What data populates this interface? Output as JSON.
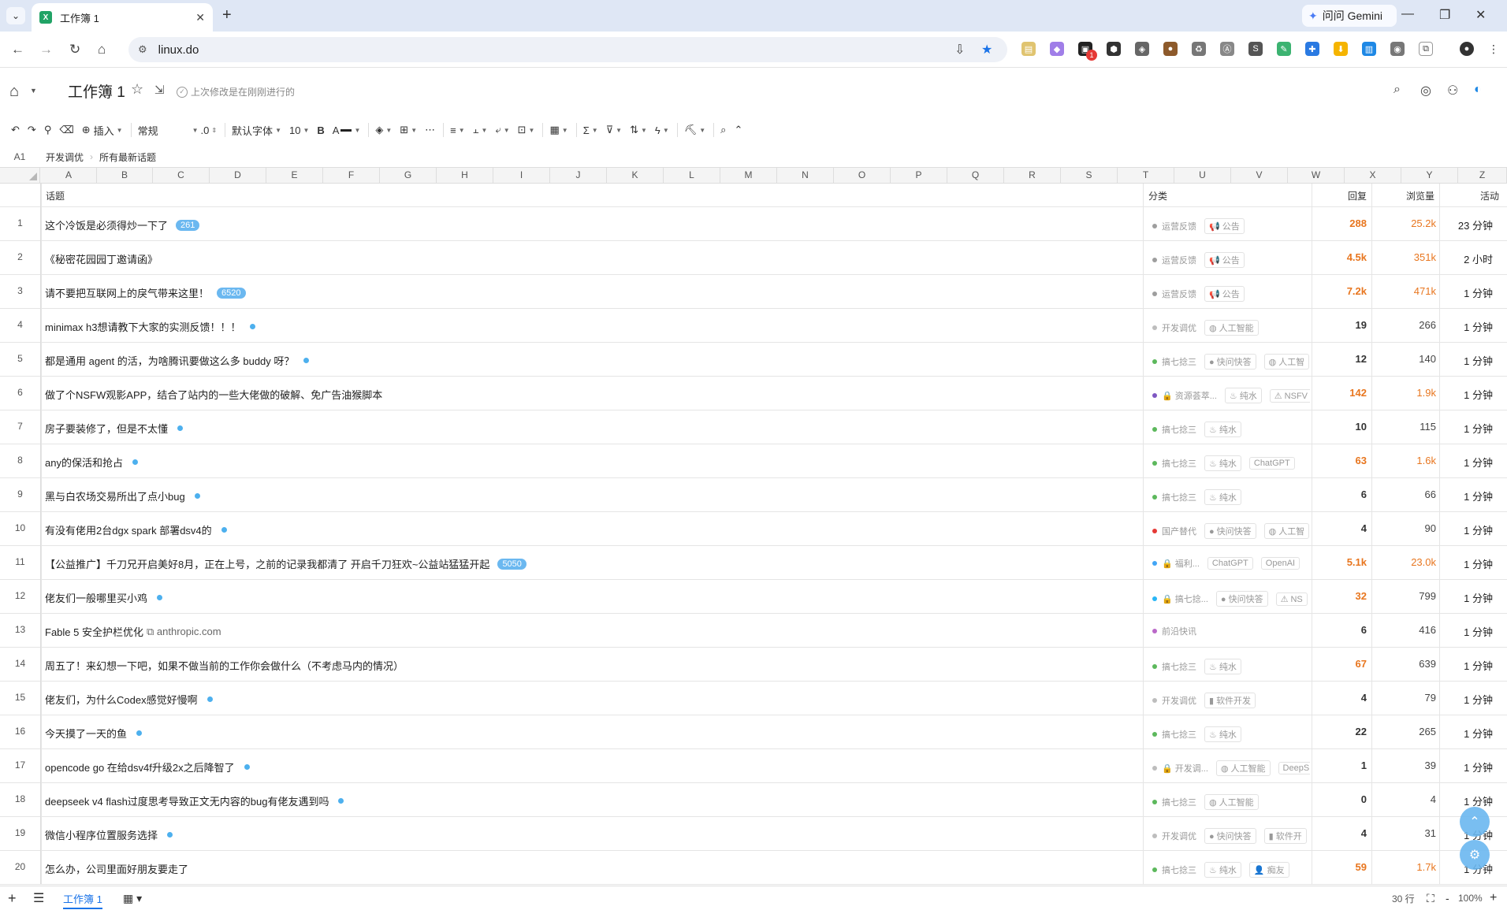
{
  "browser": {
    "tab_title": "工作簿 1",
    "tab_favicon": "X",
    "new_tab": "+",
    "tab_list": "⌄",
    "gemini_label": "问问 Gemini",
    "url": "linux.do",
    "ext_badge": "1"
  },
  "app": {
    "doc_title": "工作簿 1",
    "save_status": "上次修改是在刚刚进行的"
  },
  "toolbar": {
    "insert": "插入",
    "format": "常规",
    "decimal": ".0",
    "font": "默认字体",
    "font_size": "10",
    "bold": "B",
    "font_color": "A"
  },
  "formula_bar": {
    "cell_ref": "A1",
    "crumb1": "开发调优",
    "crumb2": "所有最新话题"
  },
  "columns": [
    "A",
    "B",
    "C",
    "D",
    "E",
    "F",
    "G",
    "H",
    "I",
    "J",
    "K",
    "L",
    "M",
    "N",
    "O",
    "P",
    "Q",
    "R",
    "S",
    "T",
    "U",
    "V",
    "W",
    "X",
    "Y",
    "Z"
  ],
  "header_row": {
    "topic": "话题",
    "category": "分类",
    "replies": "回复",
    "views": "浏览量",
    "activity": "活动"
  },
  "rows": [
    {
      "n": "1",
      "topic": "这个冷饭是必须得炒一下了",
      "badge": "261",
      "dot": false,
      "cat": "运营反馈",
      "cat_color": "#9e9e9e",
      "tags": [
        {
          "i": "📢",
          "t": "公告"
        }
      ],
      "replies": "288",
      "rep_hot": true,
      "views": "25.2k",
      "view_hot": true,
      "activity": "23 分钟"
    },
    {
      "n": "2",
      "topic": "《秘密花园园丁邀请函》",
      "badge": "",
      "dot": false,
      "cat": "运营反馈",
      "cat_color": "#9e9e9e",
      "tags": [
        {
          "i": "📢",
          "t": "公告"
        }
      ],
      "replies": "4.5k",
      "rep_hot": true,
      "views": "351k",
      "view_hot": true,
      "activity": "2 小时"
    },
    {
      "n": "3",
      "topic": "请不要把互联网上的戾气带来这里！",
      "badge": "6520",
      "dot": false,
      "cat": "运营反馈",
      "cat_color": "#9e9e9e",
      "tags": [
        {
          "i": "📢",
          "t": "公告"
        }
      ],
      "replies": "7.2k",
      "rep_hot": true,
      "views": "471k",
      "view_hot": true,
      "activity": "1 分钟"
    },
    {
      "n": "4",
      "topic": "minimax h3想请教下大家的实测反馈！！！",
      "badge": "",
      "dot": true,
      "cat": "开发调优",
      "cat_color": "#bdbdbd",
      "tags": [
        {
          "i": "◍",
          "t": "人工智能"
        }
      ],
      "replies": "19",
      "rep_hot": false,
      "views": "266",
      "view_hot": false,
      "activity": "1 分钟"
    },
    {
      "n": "5",
      "topic": "都是通用 agent 的活，为啥腾讯要做这么多 buddy 呀？",
      "badge": "",
      "dot": true,
      "cat": "搞七捻三",
      "cat_color": "#5cb85c",
      "tags": [
        {
          "i": "●",
          "t": "快问快答"
        },
        {
          "i": "◍",
          "t": "人工智"
        }
      ],
      "replies": "12",
      "rep_hot": false,
      "views": "140",
      "view_hot": false,
      "activity": "1 分钟"
    },
    {
      "n": "6",
      "topic": "做了个NSFW观影APP，结合了站内的一些大佬做的破解、免广告油猴脚本",
      "badge": "",
      "dot": false,
      "cat": "🔒 资源荟萃...",
      "cat_color": "#7e57c2",
      "tags": [
        {
          "i": "♨",
          "t": "纯水"
        },
        {
          "i": "⚠",
          "t": "NSFV"
        }
      ],
      "replies": "142",
      "rep_hot": true,
      "views": "1.9k",
      "view_hot": true,
      "activity": "1 分钟"
    },
    {
      "n": "7",
      "topic": "房子要装修了，但是不太懂",
      "badge": "",
      "dot": true,
      "cat": "搞七捻三",
      "cat_color": "#5cb85c",
      "tags": [
        {
          "i": "♨",
          "t": "纯水"
        }
      ],
      "replies": "10",
      "rep_hot": false,
      "views": "115",
      "view_hot": false,
      "activity": "1 分钟"
    },
    {
      "n": "8",
      "topic": "any的保活和抢占",
      "badge": "",
      "dot": true,
      "cat": "搞七捻三",
      "cat_color": "#5cb85c",
      "tags": [
        {
          "i": "♨",
          "t": "纯水"
        },
        {
          "i": "",
          "t": "ChatGPT"
        }
      ],
      "replies": "63",
      "rep_hot": true,
      "views": "1.6k",
      "view_hot": true,
      "activity": "1 分钟"
    },
    {
      "n": "9",
      "topic": "黑与白农场交易所出了点小bug",
      "badge": "",
      "dot": true,
      "cat": "搞七捻三",
      "cat_color": "#5cb85c",
      "tags": [
        {
          "i": "♨",
          "t": "纯水"
        }
      ],
      "replies": "6",
      "rep_hot": false,
      "views": "66",
      "view_hot": false,
      "activity": "1 分钟"
    },
    {
      "n": "10",
      "topic": "有没有佬用2台dgx spark 部署dsv4的",
      "badge": "",
      "dot": true,
      "cat": "国产替代",
      "cat_color": "#e53935",
      "tags": [
        {
          "i": "●",
          "t": "快问快答"
        },
        {
          "i": "◍",
          "t": "人工智"
        }
      ],
      "replies": "4",
      "rep_hot": false,
      "views": "90",
      "view_hot": false,
      "activity": "1 分钟"
    },
    {
      "n": "11",
      "topic": "【公益推广】千刀兄开启美好8月，正在上号，之前的记录我都清了 开启千刀狂欢~公益站猛猛开起",
      "badge": "5050",
      "dot": false,
      "cat": "🔒 福利...",
      "cat_color": "#42a5f5",
      "tags": [
        {
          "i": "",
          "t": "ChatGPT"
        },
        {
          "i": "",
          "t": "OpenAI"
        }
      ],
      "replies": "5.1k",
      "rep_hot": true,
      "views": "23.0k",
      "view_hot": true,
      "activity": "1 分钟"
    },
    {
      "n": "12",
      "topic": "佬友们一般哪里买小鸡",
      "badge": "",
      "dot": true,
      "cat": "🔒 搞七捻...",
      "cat_color": "#29b6f6",
      "tags": [
        {
          "i": "●",
          "t": "快问快答"
        },
        {
          "i": "⚠",
          "t": "NS"
        }
      ],
      "replies": "32",
      "rep_hot": true,
      "views": "799",
      "view_hot": false,
      "activity": "1 分钟"
    },
    {
      "n": "13",
      "topic": "Fable 5 安全护栏优化",
      "badge": "",
      "dot": false,
      "link": "anthropic.com",
      "cat": "前沿快讯",
      "cat_color": "#ba68c8",
      "tags": [],
      "replies": "6",
      "rep_hot": false,
      "views": "416",
      "view_hot": false,
      "activity": "1 分钟"
    },
    {
      "n": "14",
      "topic": "周五了！来幻想一下吧，如果不做当前的工作你会做什么（不考虑马内的情况）",
      "badge": "",
      "dot": false,
      "cat": "搞七捻三",
      "cat_color": "#5cb85c",
      "tags": [
        {
          "i": "♨",
          "t": "纯水"
        }
      ],
      "replies": "67",
      "rep_hot": true,
      "views": "639",
      "view_hot": false,
      "activity": "1 分钟"
    },
    {
      "n": "15",
      "topic": "佬友们，为什么Codex感觉好慢啊",
      "badge": "",
      "dot": true,
      "cat": "开发调优",
      "cat_color": "#bdbdbd",
      "tags": [
        {
          "i": "▮",
          "t": "软件开发"
        }
      ],
      "replies": "4",
      "rep_hot": false,
      "views": "79",
      "view_hot": false,
      "activity": "1 分钟"
    },
    {
      "n": "16",
      "topic": "今天摸了一天的鱼",
      "badge": "",
      "dot": true,
      "cat": "搞七捻三",
      "cat_color": "#5cb85c",
      "tags": [
        {
          "i": "♨",
          "t": "纯水"
        }
      ],
      "replies": "22",
      "rep_hot": false,
      "views": "265",
      "view_hot": false,
      "activity": "1 分钟"
    },
    {
      "n": "17",
      "topic": "opencode go 在给dsv4f升级2x之后降智了",
      "badge": "",
      "dot": true,
      "cat": "🔒 开发调...",
      "cat_color": "#bdbdbd",
      "tags": [
        {
          "i": "◍",
          "t": "人工智能"
        },
        {
          "i": "",
          "t": "DeepS"
        }
      ],
      "replies": "1",
      "rep_hot": false,
      "views": "39",
      "view_hot": false,
      "activity": "1 分钟"
    },
    {
      "n": "18",
      "topic": "deepseek v4 flash过度思考导致正文无内容的bug有佬友遇到吗",
      "badge": "",
      "dot": true,
      "cat": "搞七捻三",
      "cat_color": "#5cb85c",
      "tags": [
        {
          "i": "◍",
          "t": "人工智能"
        }
      ],
      "replies": "0",
      "rep_hot": false,
      "views": "4",
      "view_hot": false,
      "activity": "1 分钟"
    },
    {
      "n": "19",
      "topic": "微信小程序位置服务选择",
      "badge": "",
      "dot": true,
      "cat": "开发调优",
      "cat_color": "#bdbdbd",
      "tags": [
        {
          "i": "●",
          "t": "快问快答"
        },
        {
          "i": "▮",
          "t": "软件开"
        }
      ],
      "replies": "4",
      "rep_hot": false,
      "views": "31",
      "view_hot": false,
      "activity": "1 分钟"
    },
    {
      "n": "20",
      "topic": "怎么办，公司里面好朋友要走了",
      "badge": "",
      "dot": false,
      "cat": "搞七捻三",
      "cat_color": "#5cb85c",
      "tags": [
        {
          "i": "♨",
          "t": "纯水"
        },
        {
          "i": "👤",
          "t": "痴友"
        }
      ],
      "replies": "59",
      "rep_hot": true,
      "views": "1.7k",
      "view_hot": true,
      "activity": "1 分钟"
    }
  ],
  "bottom": {
    "sheet_name": "工作簿 1",
    "row_count": "30 行",
    "zoom": "100%",
    "add": "+",
    "minus": "-"
  },
  "colors": {
    "accent": "#1a73e8",
    "hot": "#e8761f",
    "badge": "#6bb8f0",
    "chrome_bg": "#dfe7f5"
  }
}
